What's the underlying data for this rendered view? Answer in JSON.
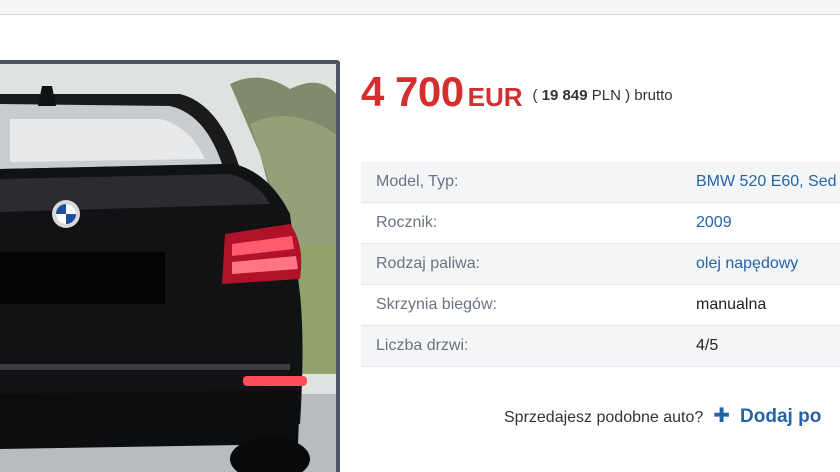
{
  "price": {
    "amount": "4 700",
    "currency": "EUR",
    "alt_open": "(",
    "alt_amount": "19 849",
    "alt_currency": "PLN",
    "alt_close": ")",
    "alt_suffix": "brutto"
  },
  "params": [
    {
      "label": "Model, Typ:",
      "value": "BMW 520 E60, Sed"
    },
    {
      "label": "Rocznik:",
      "value": "2009"
    },
    {
      "label": "Rodzaj paliwa:",
      "value": "olej napędowy"
    },
    {
      "label": "Skrzynia biegów:",
      "value": "manualna"
    },
    {
      "label": "Liczba drzwi:",
      "value": "4/5"
    }
  ],
  "cta": {
    "question": "Sprzedajesz podobne auto?",
    "plus_icon": "plus-icon",
    "add_label": "Dodaj po"
  },
  "colors": {
    "price_red": "#d32f2f",
    "link_blue": "#2563a8"
  }
}
